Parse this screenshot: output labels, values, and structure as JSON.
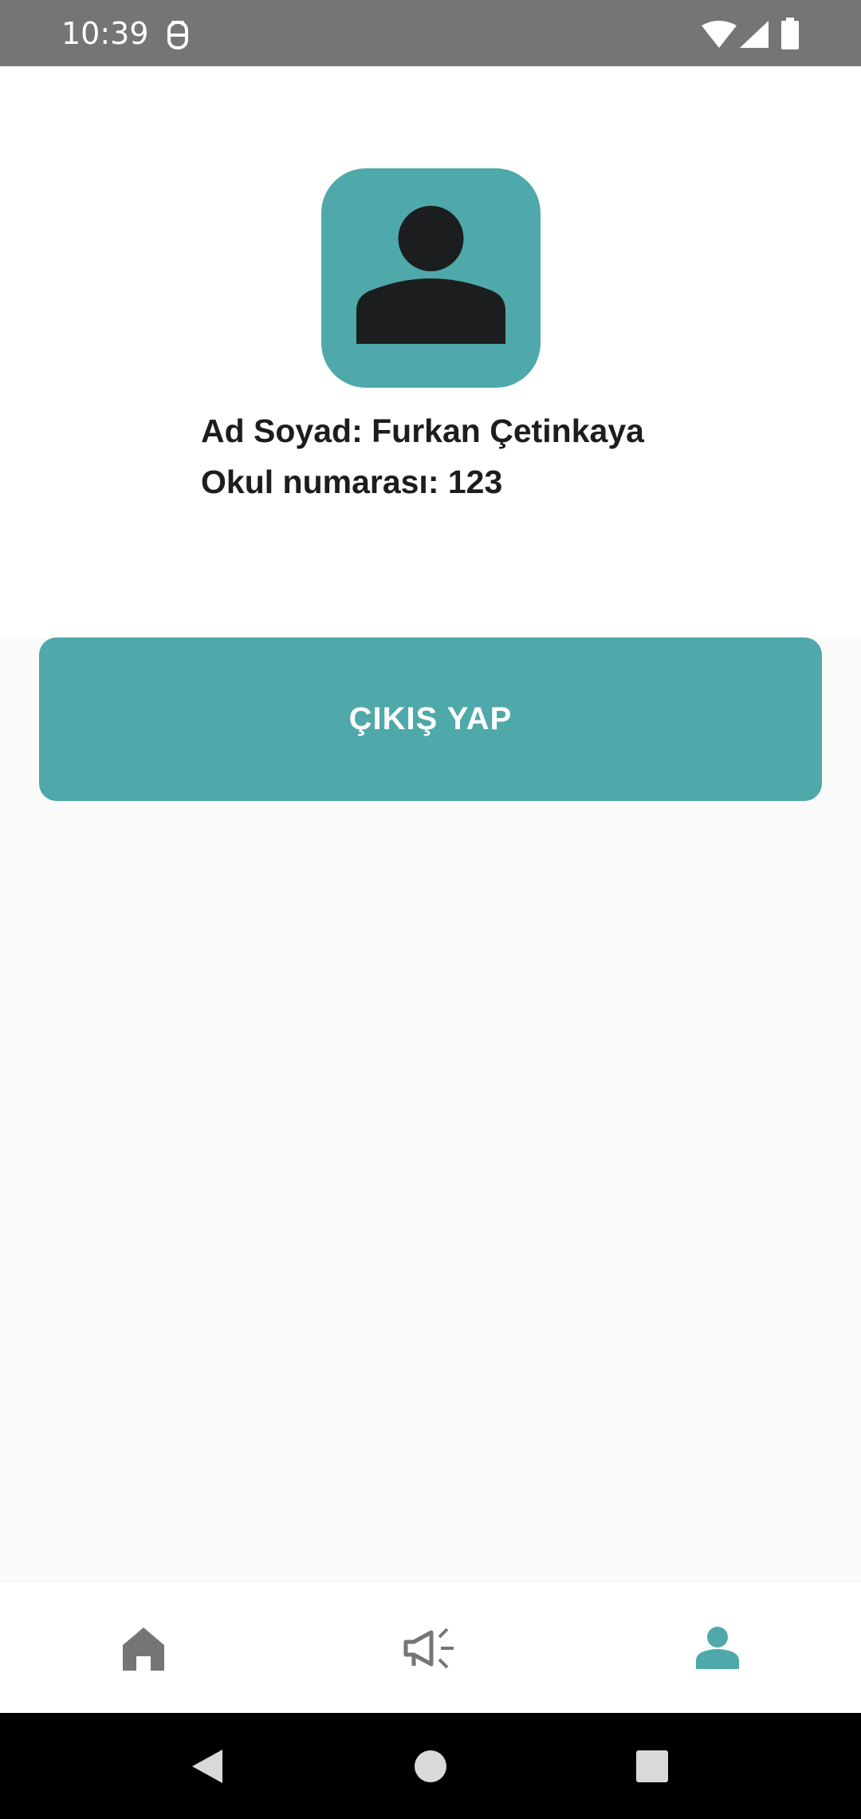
{
  "status_bar": {
    "time": "10:39",
    "icons": [
      "notification-icon",
      "wifi-icon",
      "signal-icon",
      "battery-icon"
    ]
  },
  "profile": {
    "avatar_icon": "person-icon",
    "name_line": "Ad Soyad: Furkan Çetinkaya",
    "number_line": "Okul numarası: 123"
  },
  "actions": {
    "logout_label": "ÇIKIŞ YAP"
  },
  "bottom_nav": {
    "items": [
      {
        "icon": "home-icon",
        "active": false
      },
      {
        "icon": "megaphone-icon",
        "active": false
      },
      {
        "icon": "person-icon",
        "active": true
      }
    ]
  },
  "colors": {
    "accent": "#4fa8aa",
    "text": "#1b1d1f",
    "inactive_icon": "#757575",
    "status_bar": "#757575"
  }
}
